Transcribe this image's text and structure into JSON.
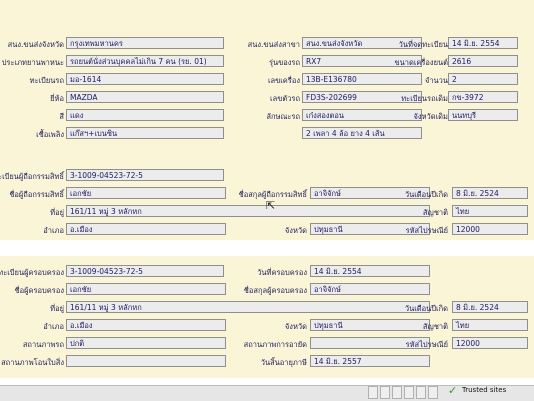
{
  "vehicle": {
    "province_office_label": "สนง.ขนส่งจังหวัด",
    "province_office_value": "กรุงเทพมหานคร",
    "branch_office_label": "สนง.ขนส่งสาขา",
    "branch_office_value": "สนง.ขนส่งจังหวัด",
    "reg_date_label": "วันที่จดทะเบียน",
    "reg_date_value": "14 มิ.ย. 2554",
    "vehicle_type_label": "ประเภทยานพาหนะ",
    "vehicle_type_value": "รถยนต์นั่งส่วนบุคคลไม่เกิน 7 คน (รย. 01)",
    "model_label": "รุ่นของรถ",
    "model_value": "RX7",
    "engine_cc_label": "ขนาดเครื่องยนต์",
    "engine_cc_value": "2616",
    "plate_label": "ทะเบียนรถ",
    "plate_value": "มอ-1614",
    "engine_no_label": "เลขเครื่อง",
    "engine_no_value": "13B-E136780",
    "qty_label": "จำนวน",
    "qty_value": "2",
    "brand_label": "ยี่ห้อ",
    "brand_value": "MAZDA",
    "chassis_label": "เลขตัวรถ",
    "chassis_value": "FD3S-202699",
    "old_plate_label": "ทะเบียนรถเดิม",
    "old_plate_value": "กข-3972",
    "color_label": "สี",
    "color_value": "แดง",
    "vehicle_feature_label": "ลักษณะรถ",
    "vehicle_feature_value": "เก๋งสองตอน",
    "old_province_label": "จังหวัดเดิม",
    "old_province_value": "นนทบุรี",
    "fuel_label": "เชื้อเพลิง",
    "fuel_value": "แก๊สฯ+เบนซิน",
    "doors_value": "2 เพลา 4 ล้อ ยาง 4 เส้น"
  },
  "owner": {
    "owner_id_label": "ทะเบียนผู้ถือกรรมสิทธิ์",
    "owner_id_value": "3-1009-04523-72-5",
    "owner_first_label": "ชื่อผู้ถือกรรมสิทธิ์",
    "owner_first_value": "เอกชัย",
    "owner_last_label": "ชื่อสกุลผู้ถือกรรมสิทธิ์",
    "owner_last_value": "อาจิจักษ์",
    "birth_label": "วันเดือนปีเกิด",
    "birth_value": "8 มิ.ย. 2524",
    "address_label": "ที่อยู่",
    "address_value": "161/11 หมู่ 3 หลักหก",
    "nation_label": "สัญชาติ",
    "nation_value": "ไทย",
    "district_label": "อำเภอ",
    "district_value": "อ.เมือง",
    "province_label": "จังหวัด",
    "province_value": "ปทุมธานี",
    "zip_label": "รหัสไปรษณีย์",
    "zip_value": "12000"
  },
  "possessor": {
    "id_label": "ทะเบียนผู้ครอบครอง",
    "id_value": "3-1009-04523-72-5",
    "possess_date_label": "วันที่ครอบครอง",
    "possess_date_value": "14 มิ.ย. 2554",
    "first_label": "ชื่อผู้ครอบครอง",
    "first_value": "เอกชัย",
    "last_label": "ชื่อสกุลผู้ครอบครอง",
    "last_value": "อาจิจักษ์",
    "birth_label": "วันเดือนปีเกิด",
    "birth_value": "8 มิ.ย. 2524",
    "address_label": "ที่อยู่",
    "address_value": "161/11 หมู่ 3 หลักหก",
    "nation_label": "สัญชาติ",
    "nation_value": "ไทย",
    "district_label": "อำเภอ",
    "district_value": "อ.เมือง",
    "province_label": "จังหวัด",
    "province_value": "ปทุมธานี",
    "zip_label": "รหัสไปรษณีย์",
    "zip_value": "12000",
    "status_label": "สถานภาพรถ",
    "status_value": "ปกติ",
    "tax_status_label": "สถานภาพการอายัด",
    "tax_status_value": "",
    "mortgage_label": "สถานภาพโอนใบสิ่ง",
    "mortgage_value": "",
    "expire_label": "วันสิ้นอายุภาษี",
    "expire_value": "14 มิ.ย. 2557"
  },
  "status_bar": {
    "trusted_text": "Trusted sites"
  }
}
